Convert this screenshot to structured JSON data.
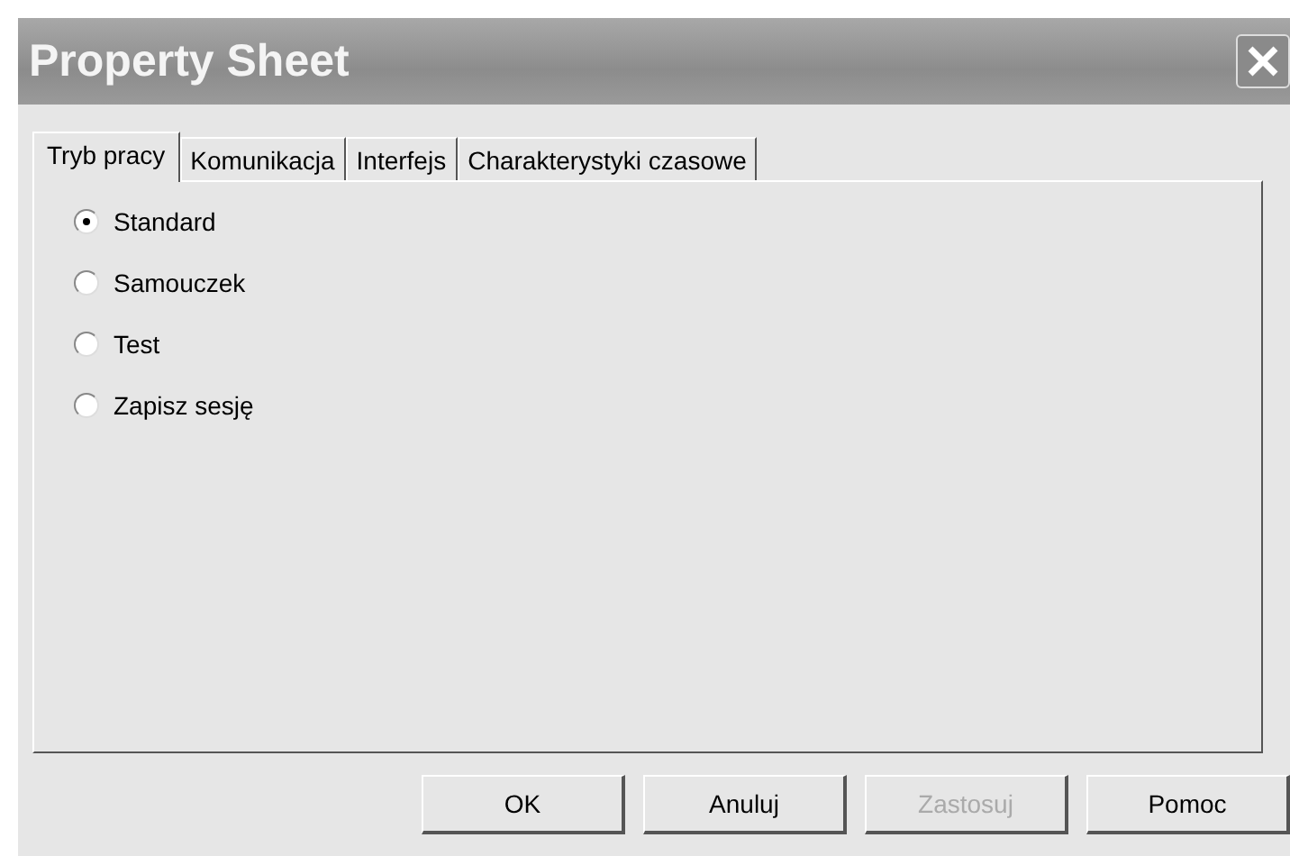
{
  "window": {
    "title": "Property Sheet"
  },
  "tabs": [
    {
      "label": "Tryb pracy",
      "selected": true
    },
    {
      "label": "Komunikacja",
      "selected": false
    },
    {
      "label": "Interfejs",
      "selected": false
    },
    {
      "label": "Charakterystyki czasowe",
      "selected": false
    }
  ],
  "options": [
    {
      "label": "Standard",
      "selected": true
    },
    {
      "label": "Samouczek",
      "selected": false
    },
    {
      "label": "Test",
      "selected": false
    },
    {
      "label": "Zapisz sesję",
      "selected": false
    }
  ],
  "buttons": [
    {
      "label": "OK",
      "disabled": false
    },
    {
      "label": "Anuluj",
      "disabled": false
    },
    {
      "label": "Zastosuj",
      "disabled": true
    },
    {
      "label": "Pomoc",
      "disabled": false
    }
  ]
}
